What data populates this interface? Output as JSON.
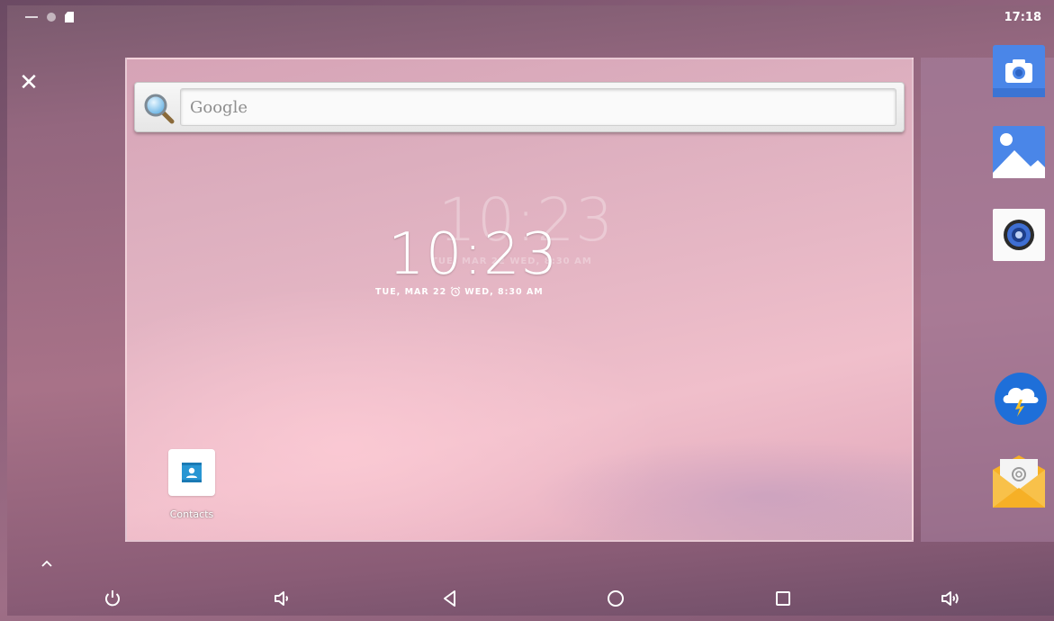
{
  "status_bar": {
    "time": "17:18"
  },
  "search": {
    "placeholder": "Google"
  },
  "clock": {
    "time": "10:23",
    "date": "TUE, MAR 22",
    "alarm": "WED, 8:30 AM",
    "ghost_time": "10:23",
    "ghost_date": "TUE, MAR 22 WED, 8:30 AM"
  },
  "desktop_apps": [
    {
      "label": "Contacts",
      "icon": "contacts-icon"
    }
  ],
  "dock_apps": [
    {
      "icon": "camera-icon"
    },
    {
      "icon": "gallery-icon"
    },
    {
      "icon": "speaker-icon"
    },
    {
      "icon": "weather-icon"
    },
    {
      "icon": "email-icon"
    }
  ],
  "nav_icons": [
    "power-icon",
    "volume-down-icon",
    "back-icon",
    "home-icon",
    "recents-icon",
    "volume-up-icon"
  ],
  "colors": {
    "dock_blue": "#4a86e8",
    "weather_blue": "#1e6fd9",
    "email_orange": "#f6b026",
    "contacts_blue": "#2896d3"
  }
}
